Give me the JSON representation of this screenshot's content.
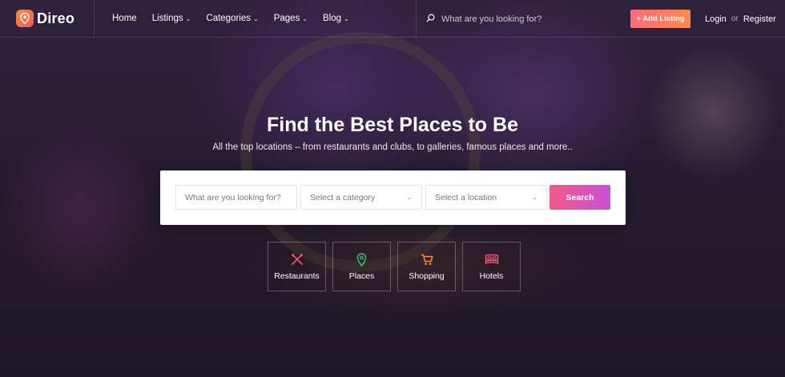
{
  "brand": {
    "name": "Direo"
  },
  "nav": [
    {
      "label": "Home",
      "has_dropdown": false
    },
    {
      "label": "Listings",
      "has_dropdown": true
    },
    {
      "label": "Categories",
      "has_dropdown": true
    },
    {
      "label": "Pages",
      "has_dropdown": true
    },
    {
      "label": "Blog",
      "has_dropdown": true
    }
  ],
  "header_search": {
    "placeholder": "What are you looking for?"
  },
  "add_listing": {
    "label": "+ Add Listing"
  },
  "auth": {
    "login": "Login",
    "or": "or",
    "register": "Register"
  },
  "hero": {
    "title": "Find the Best Places to Be",
    "subtitle": "All the top locations – from restaurants and clubs, to galleries, famous places and more.."
  },
  "search_form": {
    "keyword_placeholder": "What are you looking for?",
    "category_placeholder": "Select a category",
    "location_placeholder": "Select a location",
    "button": "Search"
  },
  "categories": [
    {
      "label": "Restaurants",
      "icon": "utensils-icon",
      "color": "#f0506e"
    },
    {
      "label": "Places",
      "icon": "map-pin-icon",
      "color": "#2fbf71"
    },
    {
      "label": "Shopping",
      "icon": "cart-icon",
      "color": "#ff8a3d"
    },
    {
      "label": "Hotels",
      "icon": "bed-icon",
      "color": "#f0506e"
    }
  ],
  "colors": {
    "accent_orange": "#ff8a4b",
    "accent_pink": "#f05a8a",
    "accent_purple": "#c94fd6"
  }
}
